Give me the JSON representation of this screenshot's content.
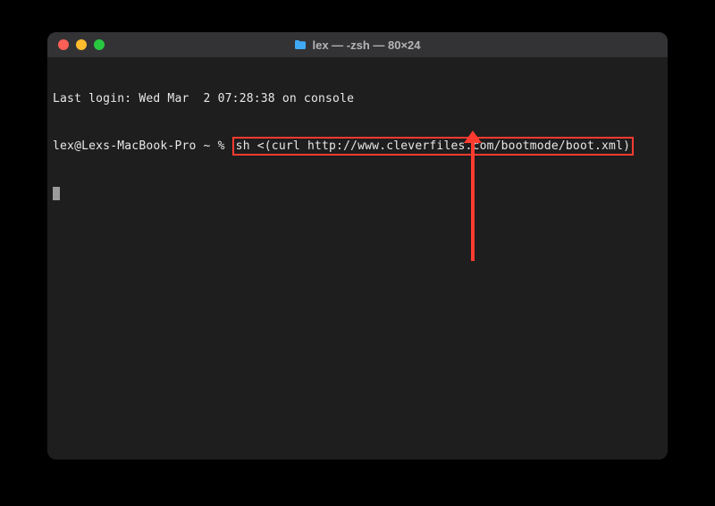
{
  "window": {
    "title": "lex — -zsh — 80×24"
  },
  "terminal": {
    "last_login": "Last login: Wed Mar  2 07:28:38 on console",
    "prompt": "lex@Lexs-MacBook-Pro ~ % ",
    "command": "sh <(curl http://www.cleverfiles.com/bootmode/boot.xml)"
  },
  "annotation": {
    "color": "#ff3b30"
  }
}
